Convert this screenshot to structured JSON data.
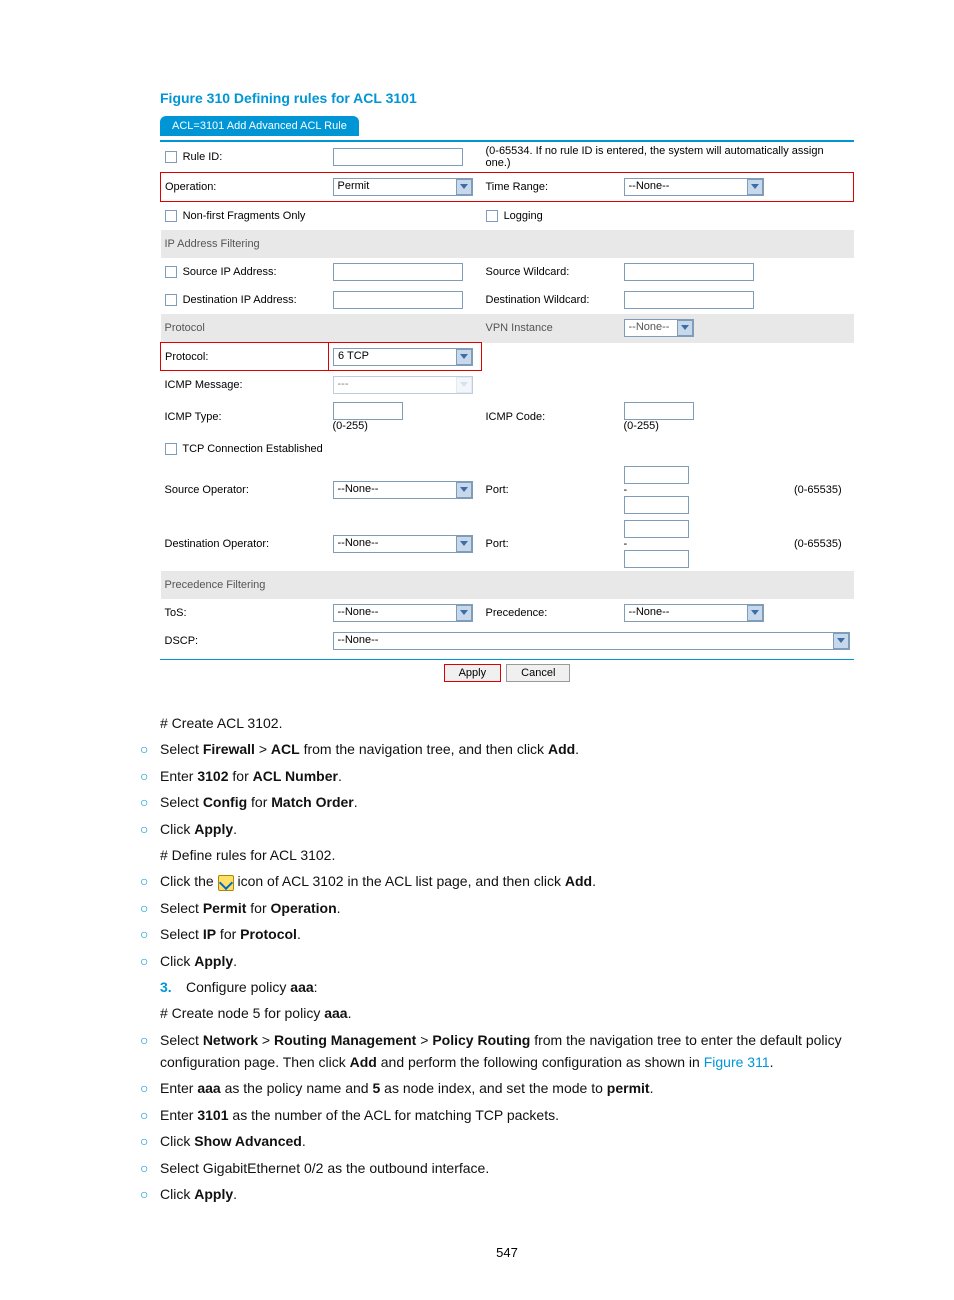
{
  "figure": {
    "title": "Figure 310 Defining rules for ACL 3101"
  },
  "tab": {
    "label": "ACL=3101 Add Advanced ACL Rule"
  },
  "form": {
    "rule_id_label": "Rule ID:",
    "rule_id_note": "(0-65534. If no rule ID is entered, the system will automatically assign one.)",
    "operation_label": "Operation:",
    "operation_value": "Permit",
    "time_range_label": "Time Range:",
    "time_range_value": "--None--",
    "nff_label": "Non-first Fragments Only",
    "logging_label": "Logging",
    "ip_filter_header": "IP Address Filtering",
    "src_ip_label": "Source IP Address:",
    "src_wc_label": "Source Wildcard:",
    "dst_ip_label": "Destination IP Address:",
    "dst_wc_label": "Destination Wildcard:",
    "protocol_header": "Protocol",
    "vpn_instance_label": "VPN Instance",
    "vpn_instance_value": "--None--",
    "protocol_label": "Protocol:",
    "protocol_value": "6 TCP",
    "icmp_msg_label": "ICMP Message:",
    "icmp_msg_value": "---",
    "icmp_type_label": "ICMP Type:",
    "icmp_type_range": "(0-255)",
    "icmp_code_label": "ICMP Code:",
    "icmp_code_range": "(0-255)",
    "tcp_est_label": "TCP Connection Established",
    "src_op_label": "Source Operator:",
    "src_op_value": "--None--",
    "port_label_a": "Port:",
    "port_range_a": "(0-65535)",
    "dst_op_label": "Destination Operator:",
    "dst_op_value": "--None--",
    "port_label_b": "Port:",
    "port_range_b": "(0-65535)",
    "prec_header": "Precedence Filtering",
    "tos_label": "ToS:",
    "tos_value": "--None--",
    "prec_label": "Precedence:",
    "prec_value": "--None--",
    "dscp_label": "DSCP:",
    "dscp_value": "--None--",
    "apply_btn": "Apply",
    "cancel_btn": "Cancel"
  },
  "instr": {
    "l1": "# Create ACL 3102.",
    "l2a": "Select ",
    "l2b": "Firewall",
    "l2c": " > ",
    "l2d": "ACL",
    "l2e": " from the navigation tree, and then click ",
    "l2f": "Add",
    "l2g": ".",
    "l3a": "Enter ",
    "l3b": "3102",
    "l3c": " for ",
    "l3d": "ACL Number",
    "l3e": ".",
    "l4a": "Select ",
    "l4b": "Config",
    "l4c": " for ",
    "l4d": "Match Order",
    "l4e": ".",
    "l5a": "Click ",
    "l5b": "Apply",
    "l5c": ".",
    "l6": "# Define rules for ACL 3102.",
    "l7a": "Click the ",
    "l7b": " icon of ACL 3102 in the ACL list page, and then click ",
    "l7c": "Add",
    "l7d": ".",
    "l8a": "Select ",
    "l8b": "Permit",
    "l8c": " for ",
    "l8d": "Operation",
    "l8e": ".",
    "l9a": "Select ",
    "l9b": "IP",
    "l9c": " for ",
    "l9d": "Protocol",
    "l9e": ".",
    "l10a": "Click ",
    "l10b": "Apply",
    "l10c": ".",
    "step3num": "3.",
    "l11a": "Configure policy ",
    "l11b": "aaa",
    "l11c": ":",
    "l12a": "# Create node 5 for policy ",
    "l12b": "aaa",
    "l12c": ".",
    "l13a": "Select ",
    "l13b": "Network",
    "l13c": " > ",
    "l13d": "Routing Management",
    "l13e": " > ",
    "l13f": "Policy Routing",
    "l13g": " from the navigation tree to enter the default policy configuration page. Then click ",
    "l13h": "Add",
    "l13i": " and perform the following configuration as shown in ",
    "l13j": "Figure 311",
    "l13k": ".",
    "l14a": "Enter ",
    "l14b": "aaa",
    "l14c": " as the policy name and ",
    "l14d": "5",
    "l14e": " as node index, and set the mode to ",
    "l14f": "permit",
    "l14g": ".",
    "l15a": "Enter ",
    "l15b": "3101",
    "l15c": " as the number of the ACL for matching TCP packets.",
    "l16a": "Click ",
    "l16b": "Show Advanced",
    "l16c": ".",
    "l17": "Select GigabitEthernet 0/2 as the outbound interface.",
    "l18a": "Click ",
    "l18b": "Apply",
    "l18c": "."
  },
  "pagenum": "547"
}
